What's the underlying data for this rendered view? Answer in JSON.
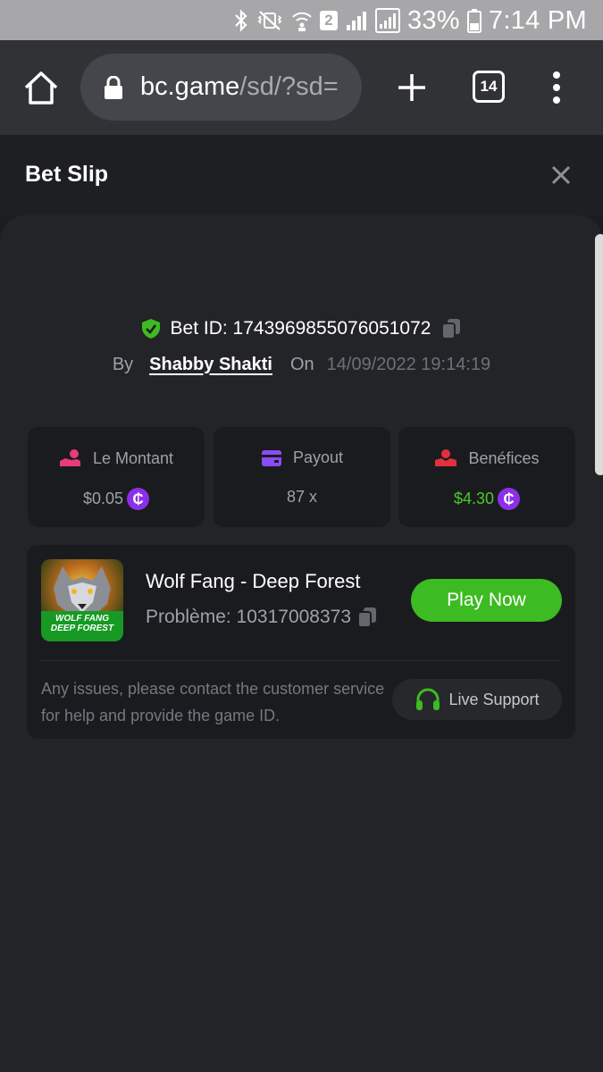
{
  "status_bar": {
    "battery_percent": "33%",
    "time": "7:14 PM",
    "sim_number": "2"
  },
  "browser": {
    "url_host": "bc.game",
    "url_path": "/sd/?sd=",
    "tab_count": "14"
  },
  "bet_slip": {
    "title": "Bet Slip",
    "bet_id": "Bet ID: 1743969855076051072",
    "by_label": "By",
    "user": "Shabby Shakti",
    "on_label": "On",
    "date": "14/09/2022 19:14:19"
  },
  "stats": [
    {
      "label": "Le Montant",
      "value": "$0.05",
      "has_coin": true,
      "icon": "money-hand-icon"
    },
    {
      "label": "Payout",
      "value": "87 x",
      "has_coin": false,
      "icon": "card-icon"
    },
    {
      "label": "Benéfices",
      "value": "$4.30",
      "has_coin": true,
      "icon": "profit-hand-icon"
    }
  ],
  "coin_symbol": "₵",
  "game": {
    "name": "Wolf Fang - Deep Forest",
    "issue": "Problème: 10317008373",
    "thumb_title_1": "WOLF FANG",
    "thumb_title_2": "DEEP FOREST",
    "play_label": "Play Now",
    "help_text": "Any issues, please contact the customer service for help and provide the game ID.",
    "support_label": "Live Support"
  },
  "colors": {
    "accent_green": "#3dbb22",
    "profit_green": "#49c92b",
    "coin_purple": "#8c2fe8",
    "amount_pink": "#e63c7a",
    "payout_purple": "#8a4cf6",
    "profit_red": "#e2303f"
  }
}
